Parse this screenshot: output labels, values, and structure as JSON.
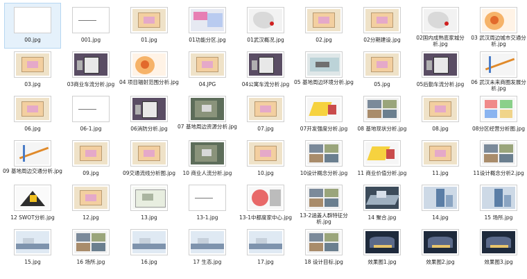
{
  "files": [
    {
      "name": "00.jpg",
      "art": "blank",
      "selected": true
    },
    {
      "name": "001.jpg",
      "art": "line"
    },
    {
      "name": "01.jpg",
      "art": "plan"
    },
    {
      "name": "01功能分区.jpg",
      "art": "func"
    },
    {
      "name": "01武汉概况.jpg",
      "art": "map"
    },
    {
      "name": "02.jpg",
      "art": "plan"
    },
    {
      "name": "02分期建设.jpg",
      "art": "plan"
    },
    {
      "name": "02国内成熟底家城分析.jpg",
      "art": "map"
    },
    {
      "name": "03 武汉周边城市交通分析.jpg",
      "art": "orange"
    },
    {
      "name": "03.jpg",
      "art": "plan"
    },
    {
      "name": "03商业车流分析.jpg",
      "art": "dark"
    },
    {
      "name": "04 项目辐射范围分析.jpg",
      "art": "orange"
    },
    {
      "name": "04.JPG",
      "art": "plan"
    },
    {
      "name": "04公寓车流分析.jpg",
      "art": "dark"
    },
    {
      "name": "05 基地周边环境分析.jpg",
      "art": "city"
    },
    {
      "name": "05.jpg",
      "art": "plan"
    },
    {
      "name": "05后勤车流分析.jpg",
      "art": "dark"
    },
    {
      "name": "06 武汉未来商圈发展分析.jpg",
      "art": "traffic"
    },
    {
      "name": "06.jpg",
      "art": "plan"
    },
    {
      "name": "06-1.jpg",
      "art": "line"
    },
    {
      "name": "06消防分析.jpg",
      "art": "dark"
    },
    {
      "name": "07 基地周边资源分析.jpg",
      "art": "sat"
    },
    {
      "name": "07.jpg",
      "art": "plan"
    },
    {
      "name": "07开发强度分析.jpg",
      "art": "yellow"
    },
    {
      "name": "08 基地现状分析.jpg",
      "art": "photos"
    },
    {
      "name": "08.jpg",
      "art": "plan"
    },
    {
      "name": "08分区经营分析图.jpg",
      "art": "quad"
    },
    {
      "name": "09 基地周边交通分析.jpg",
      "art": "traffic"
    },
    {
      "name": "09.jpg",
      "art": "plan"
    },
    {
      "name": "09交通流线分析图.jpg",
      "art": "plan"
    },
    {
      "name": "10 商业人流分析.jpg",
      "art": "sat"
    },
    {
      "name": "10.jpg",
      "art": "plan"
    },
    {
      "name": "10设计概念分析.jpg",
      "art": "photos"
    },
    {
      "name": "11 商业价值分析.jpg",
      "art": "yellow"
    },
    {
      "name": "11.jpg",
      "art": "plan"
    },
    {
      "name": "11设计概念分析2.jpg",
      "art": "photos"
    },
    {
      "name": "12 SWOT分析.jpg",
      "art": "swot"
    },
    {
      "name": "12.jpg",
      "art": "plan"
    },
    {
      "name": "13.jpg",
      "art": "site"
    },
    {
      "name": "13-1.jpg",
      "art": "line"
    },
    {
      "name": "13-1中都度家中心.jpg",
      "art": "circle"
    },
    {
      "name": "13-2涵盖人群特征分析.jpg",
      "art": "photos"
    },
    {
      "name": "14 聚合.jpg",
      "art": "perspective"
    },
    {
      "name": "14.jpg",
      "art": "tower"
    },
    {
      "name": "15 场所.jpg",
      "art": "tower"
    },
    {
      "name": "15.jpg",
      "art": "sky"
    },
    {
      "name": "16 场所.jpg",
      "art": "photos"
    },
    {
      "name": "16.jpg",
      "art": "sky"
    },
    {
      "name": "17 生态.jpg",
      "art": "sky"
    },
    {
      "name": "17.jpg",
      "art": "sky"
    },
    {
      "name": "18 设计目标.jpg",
      "art": "photos"
    },
    {
      "name": "效果图1.jpg",
      "art": "night"
    },
    {
      "name": "效果图2.jpg",
      "art": "night"
    },
    {
      "name": "效果图3.jpg",
      "art": "night"
    }
  ]
}
